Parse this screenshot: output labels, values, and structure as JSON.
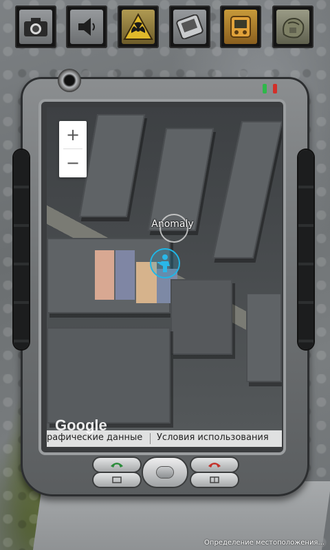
{
  "toolbar": {
    "items": [
      {
        "name": "camera",
        "icon": "camera-icon"
      },
      {
        "name": "sound",
        "icon": "speaker-icon"
      },
      {
        "name": "radiation",
        "icon": "radiation-icon"
      },
      {
        "name": "pda",
        "icon": "pda-icon"
      },
      {
        "name": "detector",
        "icon": "detector-icon"
      },
      {
        "name": "inventory",
        "icon": "backpack-icon"
      }
    ]
  },
  "map": {
    "zoom_in": "+",
    "zoom_out": "−",
    "marker_label": "Anomaly",
    "logo": "Google",
    "attribution": "рафические данные",
    "terms": "Условия использования"
  },
  "status": {
    "text": "Определение местоположения..."
  },
  "colors": {
    "led_green": "#2fb84a",
    "led_red": "#d2302a",
    "player_ring": "#1fb6e6",
    "call_green": "#2a8c3a",
    "call_red": "#c4312a"
  }
}
